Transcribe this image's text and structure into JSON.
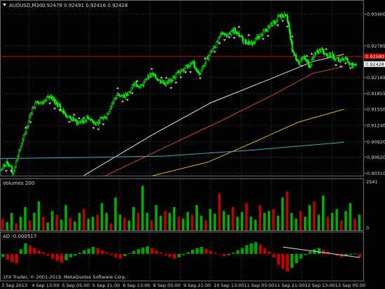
{
  "header": {
    "symbol_tf": "AUDUSD,M30",
    "ohlc": "0.92478 0.92491 0.92416 0.92428"
  },
  "volume_panel": {
    "label": "Volumes 200"
  },
  "ao_panel": {
    "label": "AO -0.000517"
  },
  "footer": {
    "copyright": "1FX Trader, © 2001-2013, MetaQuotes Software Corp."
  },
  "colors": {
    "background": "#000000",
    "grid": "#3a3a3a",
    "candle_up": "#00ff00",
    "candle_down": "#00ff00",
    "fractal": "#c0c0c0",
    "ma_white": "#e8e8e8",
    "ma_red": "#d04020",
    "ma_orange": "#e0b000",
    "ma_teal": "#30b0c0",
    "resistance": "#c00000",
    "price_tag": "#c00000",
    "volume_up": "#00b000",
    "volume_down": "#c00000",
    "ao_up": "#00a000",
    "ao_down": "#c00000",
    "trendline": "#e0e0e0"
  },
  "chart_data": {
    "type": "line",
    "title": "AUDUSD,M30",
    "price_axis": {
      "ticks": [
        "0.93400",
        "0.92785",
        "0.92169",
        "0.91855",
        "0.91550",
        "0.91240",
        "0.90920",
        "0.90620",
        "0.90310"
      ],
      "ylim": [
        0.9026,
        0.9366
      ]
    },
    "current_price_label": "0.92428",
    "resistance_label": "0.92580",
    "resistance_price": 0.9258,
    "time_axis": [
      "3 Sep 2013",
      "4 Sep 13:00",
      "5 Sep 05:00",
      "5 Sep 21:00",
      "6 Sep 13:00",
      "9 Sep 05:00",
      "9 Sep 21:00",
      "10 Sep 13:00",
      "11 Sep 05:00",
      "11 Sep 21:00",
      "12 Sep 13:00",
      "13 Sep 05:00"
    ],
    "price_series": {
      "name": "AUDUSD",
      "values": [
        0.9037,
        0.9055,
        0.9031,
        0.9071,
        0.9105,
        0.9148,
        0.9171,
        0.9166,
        0.918,
        0.9172,
        0.916,
        0.9145,
        0.9138,
        0.9128,
        0.9131,
        0.914,
        0.9128,
        0.9135,
        0.9142,
        0.9165,
        0.9188,
        0.9178,
        0.919,
        0.9207,
        0.9198,
        0.9215,
        0.9222,
        0.9212,
        0.9205,
        0.921,
        0.9222,
        0.9233,
        0.9239,
        0.9245,
        0.922,
        0.9245,
        0.9268,
        0.9282,
        0.9305,
        0.9298,
        0.931,
        0.9295,
        0.9285,
        0.9282,
        0.9295,
        0.9305,
        0.9315,
        0.9325,
        0.9338,
        0.934,
        0.927,
        0.9245,
        0.9255,
        0.924,
        0.9265,
        0.927,
        0.9262,
        0.9258,
        0.925,
        0.9255,
        0.924,
        0.9243
      ]
    },
    "moving_averages": [
      {
        "color": "white",
        "x": [
          0.23,
          0.42,
          0.58,
          0.75,
          0.86,
          0.945
        ],
        "values": [
          0.9026,
          0.9106,
          0.9168,
          0.9216,
          0.9248,
          0.9262
        ]
      },
      {
        "color": "red",
        "x": [
          0.29,
          0.45,
          0.6,
          0.75,
          0.86,
          0.945
        ],
        "values": [
          0.9026,
          0.908,
          0.913,
          0.9183,
          0.9225,
          0.9238
        ]
      },
      {
        "color": "orange",
        "x": [
          0.42,
          0.57,
          0.7,
          0.82,
          0.945
        ],
        "values": [
          0.9026,
          0.9052,
          0.9092,
          0.913,
          0.9155
        ]
      },
      {
        "color": "teal",
        "x": [
          0.0,
          0.2,
          0.45,
          0.7,
          0.945
        ],
        "values": [
          0.9059,
          0.9061,
          0.9064,
          0.9076,
          0.9091
        ]
      }
    ],
    "volume": {
      "axis_labels": [
        "2541",
        "0"
      ],
      "max": 2541,
      "values": [
        600,
        420,
        900,
        350,
        700,
        1200,
        500,
        900,
        1500,
        700,
        400,
        1000,
        800,
        550,
        1300,
        650,
        450,
        900,
        1100,
        600,
        700,
        800,
        1400,
        900,
        350,
        1700,
        800,
        650,
        500,
        1200,
        900,
        2300,
        900,
        500,
        1300,
        750,
        1000,
        900,
        1200,
        700,
        600,
        950,
        800,
        1300,
        750,
        500,
        1100,
        850,
        1900,
        1000,
        800,
        1200,
        700,
        950,
        1400,
        700,
        550,
        1300,
        900,
        1000,
        1100,
        750,
        1700,
        2000,
        900,
        600,
        1000,
        700,
        1300,
        1500,
        800,
        1800,
        700,
        900,
        1100,
        500,
        1000,
        1400,
        600,
        800
      ]
    },
    "awesome_oscillator": {
      "label": "AO -0.000517",
      "ylim": [
        -0.0035,
        0.0025
      ],
      "values": [
        -0.0005,
        -0.001,
        -0.0014,
        -0.0016,
        0.0008,
        0.0018,
        0.0014,
        0.001,
        0.0006,
        0.0003,
        -0.0003,
        -0.0008,
        -0.0012,
        -0.0015,
        -0.0011,
        -0.0006,
        -0.0003,
        0.0002,
        0.0006,
        0.0009,
        0.0012,
        0.001,
        0.0006,
        0.0003,
        -0.0002,
        -0.0006,
        -0.0008,
        -0.0004,
        0.0001,
        0.0005,
        0.0008,
        0.0011,
        0.0013,
        0.001,
        0.0006,
        0.0002,
        -0.0002,
        -0.0005,
        -0.0008,
        -0.0006,
        -0.0002,
        0.0003,
        0.0007,
        0.001,
        0.0012,
        0.0009,
        0.0005,
        0.0002,
        -0.0001,
        -0.0004,
        -0.0002,
        0.0002,
        0.0006,
        0.001,
        0.0015,
        0.0018,
        0.002,
        0.0016,
        0.001,
        0.0004,
        -0.0006,
        -0.0018,
        -0.0026,
        -0.003,
        -0.0024,
        -0.0016,
        -0.0008,
        -0.0002,
        0.0004,
        0.0008,
        0.001,
        0.0007,
        0.0004,
        0.0001,
        -0.0003,
        -0.0006,
        -0.0004,
        -0.0002,
        0.0001,
        -0.0005
      ]
    }
  }
}
